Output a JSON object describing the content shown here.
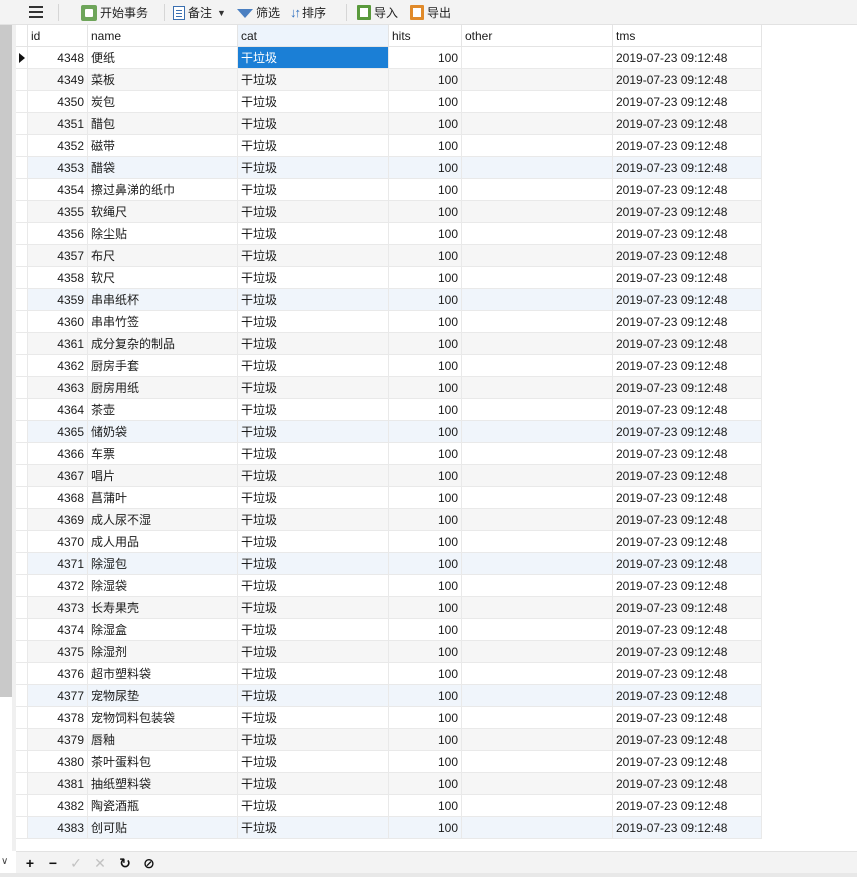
{
  "toolbar": {
    "menu_icon": "hamburger-icon",
    "begin_transaction": "开始事务",
    "note": "备注",
    "filter": "筛选",
    "sort": "排序",
    "import": "导入",
    "export": "导出"
  },
  "columns": [
    "id",
    "name",
    "cat",
    "hits",
    "other",
    "tms"
  ],
  "rows": [
    {
      "id": "4348",
      "name": "便纸",
      "cat": "干垃圾",
      "hits": "100",
      "other": "",
      "tms": "2019-07-23 09:12:48"
    },
    {
      "id": "4349",
      "name": "菜板",
      "cat": "干垃圾",
      "hits": "100",
      "other": "",
      "tms": "2019-07-23 09:12:48"
    },
    {
      "id": "4350",
      "name": "炭包",
      "cat": "干垃圾",
      "hits": "100",
      "other": "",
      "tms": "2019-07-23 09:12:48"
    },
    {
      "id": "4351",
      "name": "醋包",
      "cat": "干垃圾",
      "hits": "100",
      "other": "",
      "tms": "2019-07-23 09:12:48"
    },
    {
      "id": "4352",
      "name": "磁带",
      "cat": "干垃圾",
      "hits": "100",
      "other": "",
      "tms": "2019-07-23 09:12:48"
    },
    {
      "id": "4353",
      "name": "醋袋",
      "cat": "干垃圾",
      "hits": "100",
      "other": "",
      "tms": "2019-07-23 09:12:48"
    },
    {
      "id": "4354",
      "name": "擦过鼻涕的纸巾",
      "cat": "干垃圾",
      "hits": "100",
      "other": "",
      "tms": "2019-07-23 09:12:48"
    },
    {
      "id": "4355",
      "name": "软绳尺",
      "cat": "干垃圾",
      "hits": "100",
      "other": "",
      "tms": "2019-07-23 09:12:48"
    },
    {
      "id": "4356",
      "name": "除尘贴",
      "cat": "干垃圾",
      "hits": "100",
      "other": "",
      "tms": "2019-07-23 09:12:48"
    },
    {
      "id": "4357",
      "name": "布尺",
      "cat": "干垃圾",
      "hits": "100",
      "other": "",
      "tms": "2019-07-23 09:12:48"
    },
    {
      "id": "4358",
      "name": "软尺",
      "cat": "干垃圾",
      "hits": "100",
      "other": "",
      "tms": "2019-07-23 09:12:48"
    },
    {
      "id": "4359",
      "name": "串串纸杯",
      "cat": "干垃圾",
      "hits": "100",
      "other": "",
      "tms": "2019-07-23 09:12:48"
    },
    {
      "id": "4360",
      "name": "串串竹签",
      "cat": "干垃圾",
      "hits": "100",
      "other": "",
      "tms": "2019-07-23 09:12:48"
    },
    {
      "id": "4361",
      "name": "成分复杂的制品",
      "cat": "干垃圾",
      "hits": "100",
      "other": "",
      "tms": "2019-07-23 09:12:48"
    },
    {
      "id": "4362",
      "name": "厨房手套",
      "cat": "干垃圾",
      "hits": "100",
      "other": "",
      "tms": "2019-07-23 09:12:48"
    },
    {
      "id": "4363",
      "name": "厨房用纸",
      "cat": "干垃圾",
      "hits": "100",
      "other": "",
      "tms": "2019-07-23 09:12:48"
    },
    {
      "id": "4364",
      "name": "茶壶",
      "cat": "干垃圾",
      "hits": "100",
      "other": "",
      "tms": "2019-07-23 09:12:48"
    },
    {
      "id": "4365",
      "name": "储奶袋",
      "cat": "干垃圾",
      "hits": "100",
      "other": "",
      "tms": "2019-07-23 09:12:48"
    },
    {
      "id": "4366",
      "name": "车票",
      "cat": "干垃圾",
      "hits": "100",
      "other": "",
      "tms": "2019-07-23 09:12:48"
    },
    {
      "id": "4367",
      "name": "唱片",
      "cat": "干垃圾",
      "hits": "100",
      "other": "",
      "tms": "2019-07-23 09:12:48"
    },
    {
      "id": "4368",
      "name": "菖蒲叶",
      "cat": "干垃圾",
      "hits": "100",
      "other": "",
      "tms": "2019-07-23 09:12:48"
    },
    {
      "id": "4369",
      "name": "成人尿不湿",
      "cat": "干垃圾",
      "hits": "100",
      "other": "",
      "tms": "2019-07-23 09:12:48"
    },
    {
      "id": "4370",
      "name": "成人用品",
      "cat": "干垃圾",
      "hits": "100",
      "other": "",
      "tms": "2019-07-23 09:12:48"
    },
    {
      "id": "4371",
      "name": "除湿包",
      "cat": "干垃圾",
      "hits": "100",
      "other": "",
      "tms": "2019-07-23 09:12:48"
    },
    {
      "id": "4372",
      "name": "除湿袋",
      "cat": "干垃圾",
      "hits": "100",
      "other": "",
      "tms": "2019-07-23 09:12:48"
    },
    {
      "id": "4373",
      "name": "长寿果壳",
      "cat": "干垃圾",
      "hits": "100",
      "other": "",
      "tms": "2019-07-23 09:12:48"
    },
    {
      "id": "4374",
      "name": "除湿盒",
      "cat": "干垃圾",
      "hits": "100",
      "other": "",
      "tms": "2019-07-23 09:12:48"
    },
    {
      "id": "4375",
      "name": "除湿剂",
      "cat": "干垃圾",
      "hits": "100",
      "other": "",
      "tms": "2019-07-23 09:12:48"
    },
    {
      "id": "4376",
      "name": "超市塑料袋",
      "cat": "干垃圾",
      "hits": "100",
      "other": "",
      "tms": "2019-07-23 09:12:48"
    },
    {
      "id": "4377",
      "name": "宠物尿垫",
      "cat": "干垃圾",
      "hits": "100",
      "other": "",
      "tms": "2019-07-23 09:12:48"
    },
    {
      "id": "4378",
      "name": "宠物饲料包装袋",
      "cat": "干垃圾",
      "hits": "100",
      "other": "",
      "tms": "2019-07-23 09:12:48"
    },
    {
      "id": "4379",
      "name": "唇釉",
      "cat": "干垃圾",
      "hits": "100",
      "other": "",
      "tms": "2019-07-23 09:12:48"
    },
    {
      "id": "4380",
      "name": "茶叶蛋料包",
      "cat": "干垃圾",
      "hits": "100",
      "other": "",
      "tms": "2019-07-23 09:12:48"
    },
    {
      "id": "4381",
      "name": "抽纸塑料袋",
      "cat": "干垃圾",
      "hits": "100",
      "other": "",
      "tms": "2019-07-23 09:12:48"
    },
    {
      "id": "4382",
      "name": "陶瓷酒瓶",
      "cat": "干垃圾",
      "hits": "100",
      "other": "",
      "tms": "2019-07-23 09:12:48"
    },
    {
      "id": "4383",
      "name": "创可贴",
      "cat": "干垃圾",
      "hits": "100",
      "other": "",
      "tms": "2019-07-23 09:12:48"
    }
  ],
  "bottom_bar": {
    "add": "+",
    "delete": "−",
    "apply": "✓",
    "discard": "✕",
    "refresh": "↻",
    "stop": "⊘",
    "collapse": "∨"
  },
  "colors": {
    "selection": "#1b7fd6",
    "row_alt": "#f6f6f6",
    "row_hl": "#f0f5fb"
  }
}
